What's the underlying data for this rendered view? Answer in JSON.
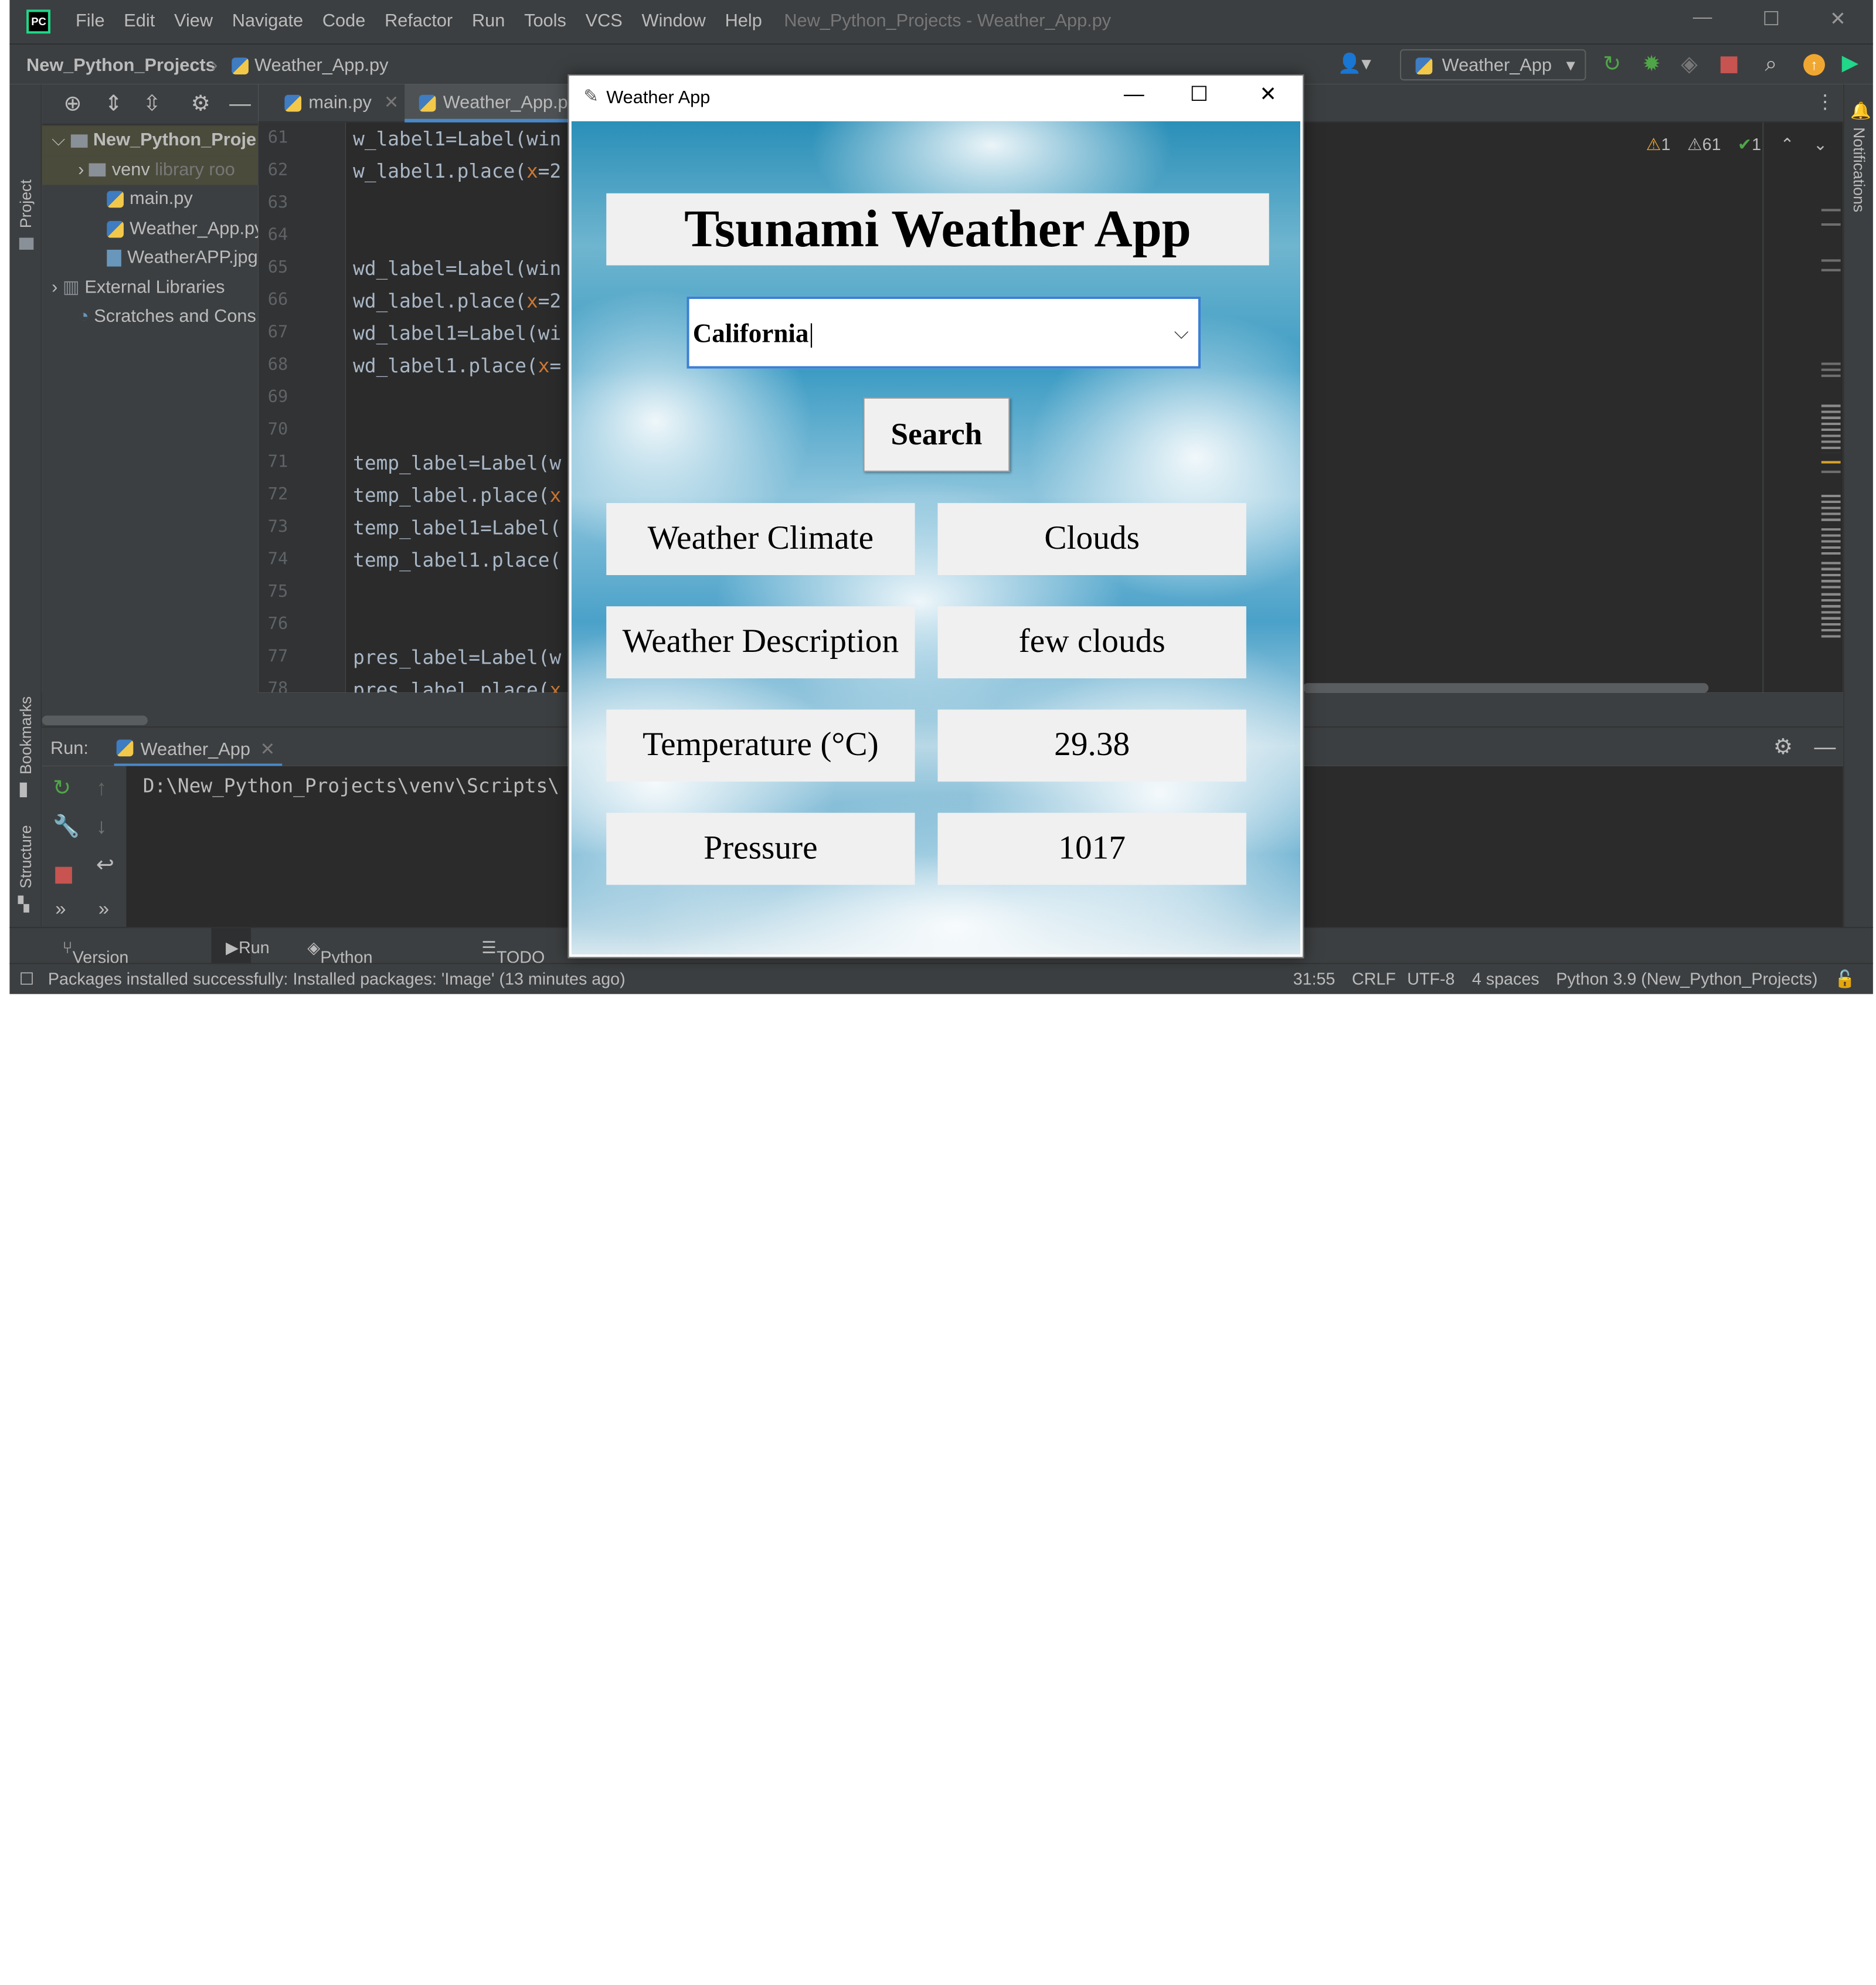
{
  "ide": {
    "menu": [
      "File",
      "Edit",
      "View",
      "Navigate",
      "Code",
      "Refactor",
      "Run",
      "Tools",
      "VCS",
      "Window",
      "Help"
    ],
    "window_title": "New_Python_Projects - Weather_App.py",
    "breadcrumb_project": "New_Python_Projects",
    "breadcrumb_file": "Weather_App.py",
    "run_config": "Weather_App",
    "tabs": [
      "main.py",
      "Weather_App.py"
    ],
    "side_project": "Project",
    "side_bookmarks": "Bookmarks",
    "side_structure": "Structure",
    "side_notifications": "Notifications",
    "tree": [
      {
        "label": "New_Python_Proje",
        "kind": "project"
      },
      {
        "label": "venv",
        "hint": "library roo",
        "kind": "folder"
      },
      {
        "label": "main.py",
        "kind": "py"
      },
      {
        "label": "Weather_App.py",
        "kind": "py"
      },
      {
        "label": "WeatherAPP.jpg",
        "kind": "img"
      },
      {
        "label": "External Libraries",
        "kind": "lib"
      },
      {
        "label": "Scratches and Cons",
        "kind": "scratch"
      }
    ],
    "line_numbers": [
      "61",
      "62",
      "63",
      "64",
      "65",
      "66",
      "67",
      "68",
      "69",
      "70",
      "71",
      "72",
      "73",
      "74",
      "75",
      "76",
      "77",
      "78"
    ],
    "code_lines": [
      "w_label1=Label(win",
      "w_label1.place(x=2",
      "",
      "",
      "wd_label=Label(win",
      "wd_label.place(x=2",
      "wd_label1=Label(wi",
      "wd_label1.place(x=",
      "",
      "",
      "temp_label=Label(w",
      "temp_label.place(x",
      "temp_label1=Label(",
      "temp_label1.place(",
      "",
      "",
      "pres_label=Label(w",
      "pres_label.place(x"
    ],
    "inspections": {
      "warn1": "1",
      "warn2": "61",
      "ok": "1"
    },
    "run_label": "Run:",
    "run_tab": "Weather_App",
    "run_output": "D:\\New_Python_Projects\\venv\\Scripts\\",
    "bottom_tabs": [
      "Version Control",
      "Run",
      "Python Packages",
      "TODO"
    ],
    "status_message": "Packages installed successfully: Installed packages: 'Image' (13 minutes ago)",
    "status_right": [
      "31:55",
      "CRLF",
      "UTF-8",
      "4 spaces",
      "Python 3.9 (New_Python_Projects)"
    ]
  },
  "weather_app": {
    "window_title": "Weather App",
    "title": "Tsunami Weather App",
    "city_value": "California",
    "search_label": "Search",
    "rows": [
      {
        "label": "Weather Climate",
        "value": "Clouds"
      },
      {
        "label": "Weather Description",
        "value": "few clouds"
      },
      {
        "label": "Temperature (°C)",
        "value": "29.38"
      },
      {
        "label": "Pressure",
        "value": "1017"
      }
    ]
  }
}
